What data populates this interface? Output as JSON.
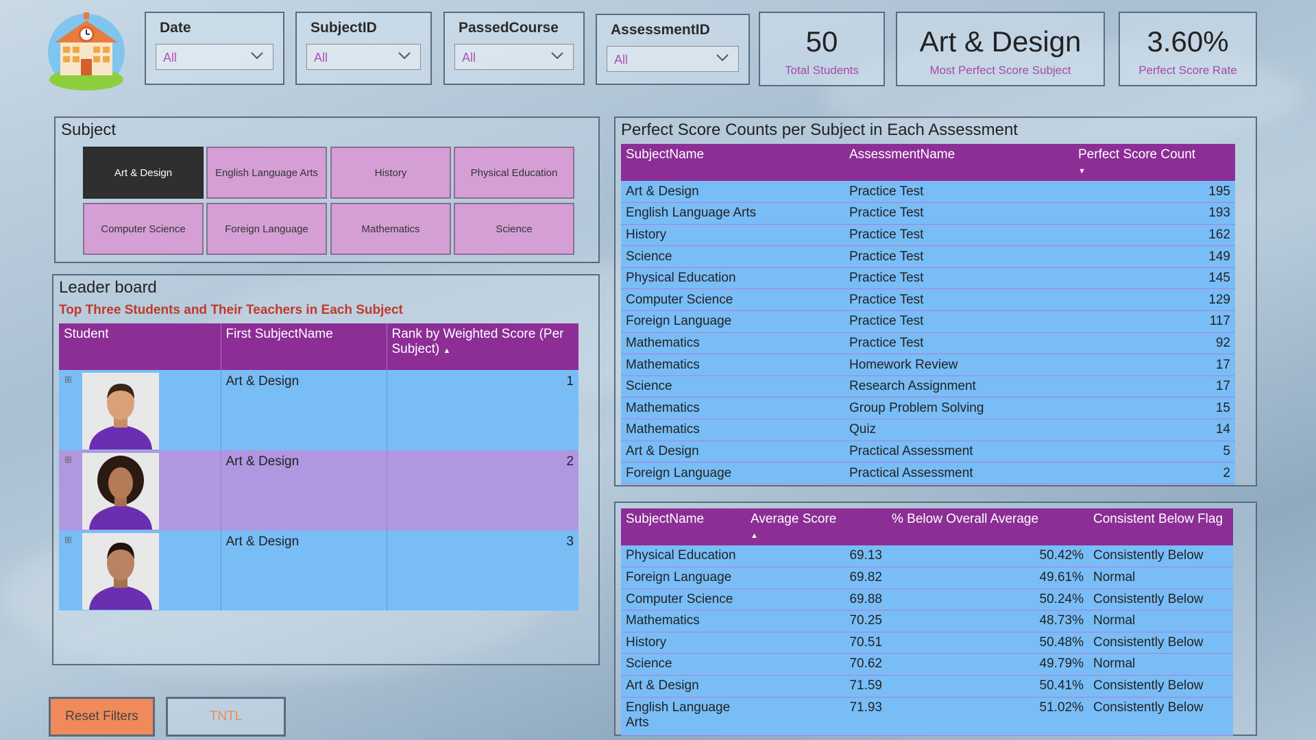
{
  "filters": [
    {
      "label": "Date",
      "value": "All"
    },
    {
      "label": "SubjectID",
      "value": "All"
    },
    {
      "label": "PassedCourse",
      "value": "All"
    },
    {
      "label": "AssessmentID",
      "value": "All"
    }
  ],
  "kpis": [
    {
      "value": "50",
      "label": "Total Students"
    },
    {
      "value": "Art & Design",
      "label": "Most Perfect Score Subject"
    },
    {
      "value": "3.60%",
      "label": "Perfect Score Rate"
    }
  ],
  "subject_panel": {
    "title": "Subject",
    "buttons": [
      "Art & Design",
      "English Language Arts",
      "History",
      "Physical Education",
      "Computer Science",
      "Foreign Language",
      "Mathematics",
      "Science"
    ]
  },
  "leaderboard": {
    "title": "Leader board",
    "subtitle": "Top Three Students and Their Teachers in Each Subject",
    "headers": [
      "Student",
      "First SubjectName",
      "Rank by Weighted Score (Per Subject)"
    ],
    "rows": [
      {
        "subject": "Art & Design",
        "rank": "1"
      },
      {
        "subject": "Art & Design",
        "rank": "2"
      },
      {
        "subject": "Art & Design",
        "rank": "3"
      }
    ]
  },
  "perfect_table": {
    "title": "Perfect Score Counts per Subject in Each Assessment",
    "headers": [
      "SubjectName",
      "AssessmentName",
      "Perfect Score Count"
    ],
    "rows": [
      [
        "Art & Design",
        "Practice Test",
        "195"
      ],
      [
        "English Language Arts",
        "Practice Test",
        "193"
      ],
      [
        "History",
        "Practice Test",
        "162"
      ],
      [
        "Science",
        "Practice Test",
        "149"
      ],
      [
        "Physical Education",
        "Practice Test",
        "145"
      ],
      [
        "Computer Science",
        "Practice Test",
        "129"
      ],
      [
        "Foreign Language",
        "Practice Test",
        "117"
      ],
      [
        "Mathematics",
        "Practice Test",
        "92"
      ],
      [
        "Mathematics",
        "Homework Review",
        "17"
      ],
      [
        "Science",
        "Research Assignment",
        "17"
      ],
      [
        "Mathematics",
        "Group Problem Solving",
        "15"
      ],
      [
        "Mathematics",
        "Quiz",
        "14"
      ],
      [
        "Art & Design",
        "Practical Assessment",
        "5"
      ],
      [
        "Foreign Language",
        "Practical Assessment",
        "2"
      ]
    ]
  },
  "average_table": {
    "headers": [
      "SubjectName",
      "Average Score",
      "% Below Overall Average",
      "Consistent Below Flag"
    ],
    "rows": [
      [
        "Physical Education",
        "69.13",
        "50.42%",
        "Consistently Below"
      ],
      [
        "Foreign Language",
        "69.82",
        "49.61%",
        "Normal"
      ],
      [
        "Computer Science",
        "69.88",
        "50.24%",
        "Consistently Below"
      ],
      [
        "Mathematics",
        "70.25",
        "48.73%",
        "Normal"
      ],
      [
        "History",
        "70.51",
        "50.48%",
        "Consistently Below"
      ],
      [
        "Science",
        "70.62",
        "49.79%",
        "Normal"
      ],
      [
        "Art & Design",
        "71.59",
        "50.41%",
        "Consistently Below"
      ],
      [
        "English Language Arts",
        "71.93",
        "51.02%",
        "Consistently Below"
      ]
    ]
  },
  "buttons": {
    "reset": "Reset Filters",
    "tntl": "TNTL"
  },
  "colors": {
    "header_purple": "#8c2e96",
    "row_blue": "#79bdf7",
    "row_purple": "#b197e0",
    "accent_pink": "#a64aa8",
    "reset_orange": "#f08a5a"
  }
}
